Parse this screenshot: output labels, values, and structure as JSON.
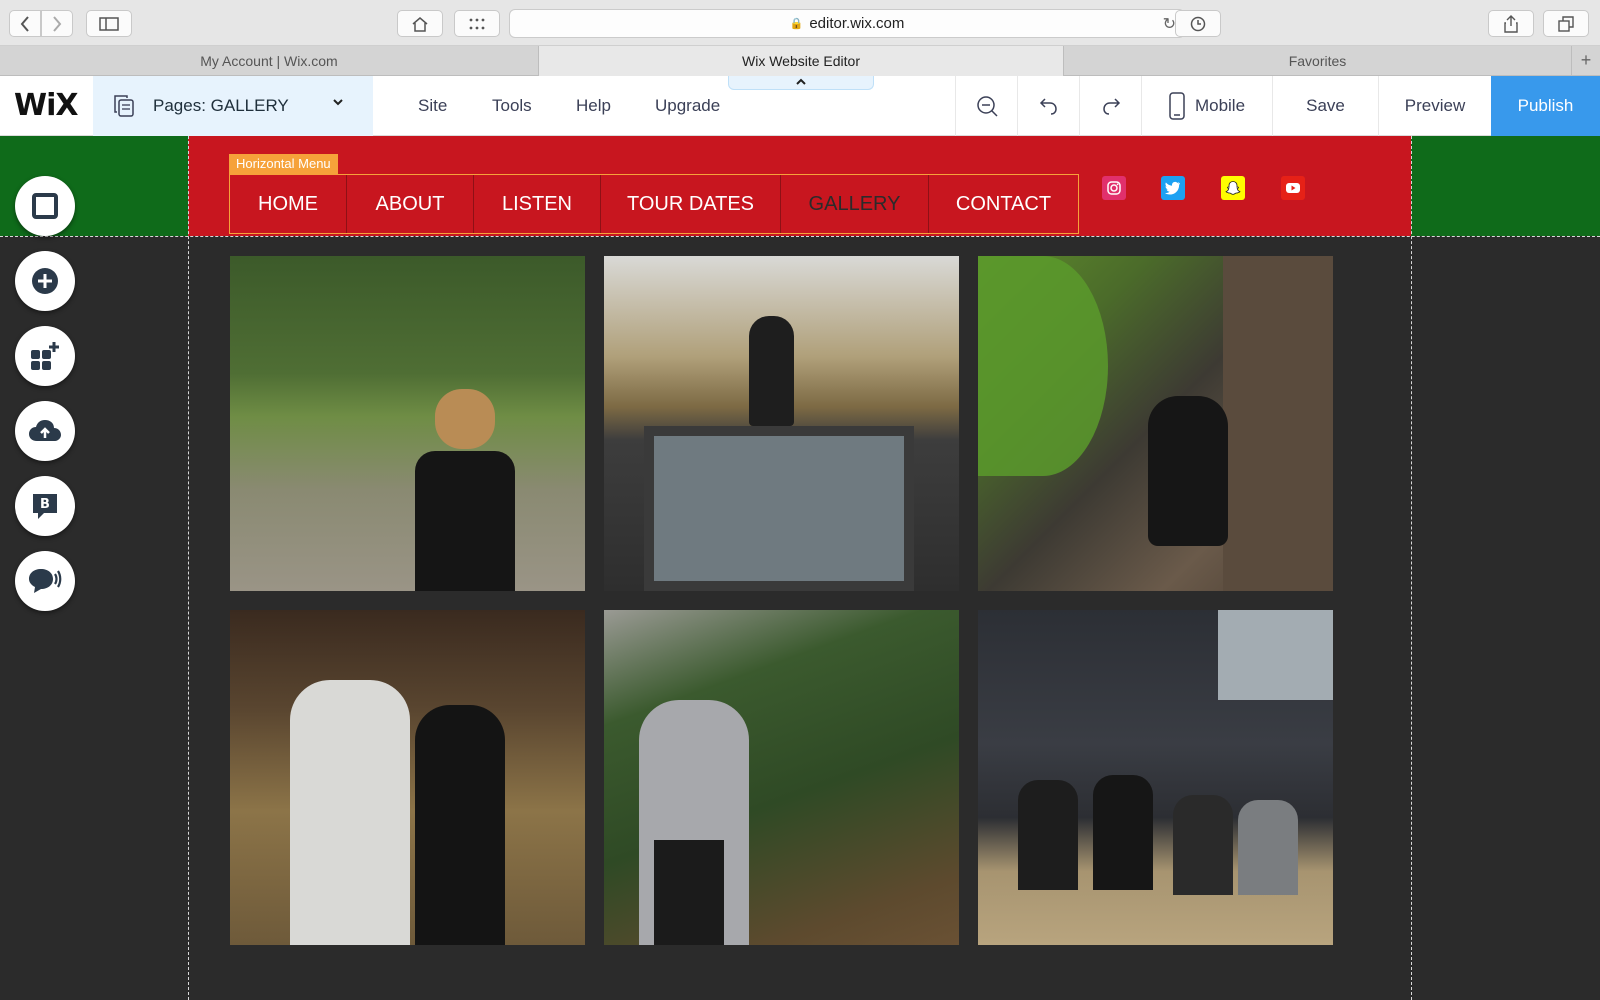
{
  "browser": {
    "url": "editor.wix.com",
    "tabs": [
      "My Account | Wix.com",
      "Wix Website Editor",
      "Favorites"
    ],
    "active_tab": 1
  },
  "editor": {
    "logo": "WiX",
    "pages_label": "Pages: GALLERY",
    "menu": [
      "Site",
      "Tools",
      "Help",
      "Upgrade"
    ],
    "mobile_label": "Mobile",
    "save_label": "Save",
    "preview_label": "Preview",
    "publish_label": "Publish"
  },
  "site": {
    "menu_tag": "Horizontal Menu",
    "nav": [
      "HOME",
      "ABOUT",
      "LISTEN",
      "TOUR DATES",
      "GALLERY",
      "CONTACT"
    ],
    "selected_nav": "GALLERY",
    "social": [
      {
        "name": "instagram",
        "color": "#e1306c"
      },
      {
        "name": "twitter",
        "color": "#1da1f2"
      },
      {
        "name": "snapchat",
        "color": "#fffc00"
      },
      {
        "name": "youtube",
        "color": "#e62117"
      }
    ]
  },
  "colors": {
    "header_red": "#c8161f",
    "header_green": "#0f6b1a",
    "publish_blue": "#3899ec",
    "menu_tag_orange": "#f6a23a"
  },
  "gallery": {
    "photos": [
      "man-in-park-with-deer-photo",
      "man-on-garage-roof-photo",
      "man-crouching-by-fence-photo",
      "two-men-in-barn-photo",
      "man-with-falling-leaves-photo",
      "four-men-on-hay-photo"
    ]
  }
}
